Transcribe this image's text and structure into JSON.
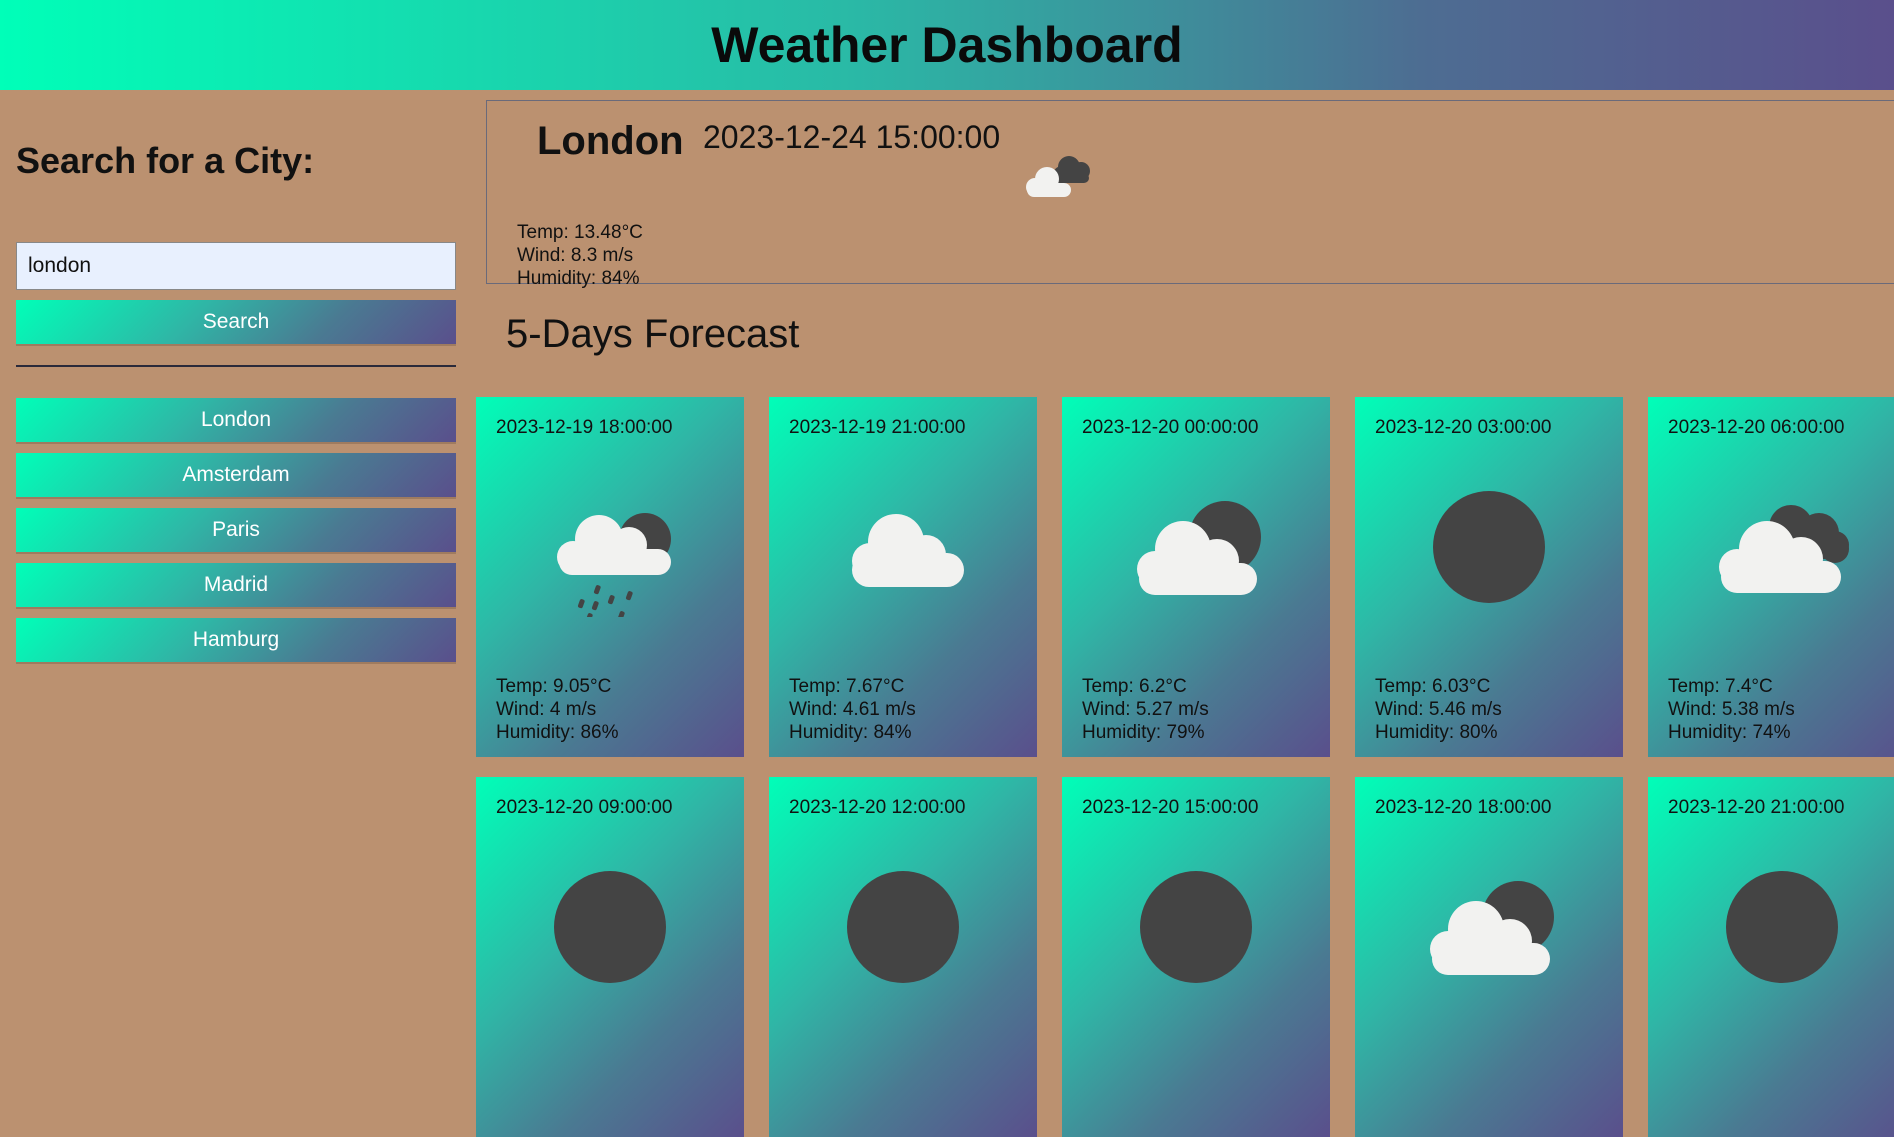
{
  "header": {
    "title": "Weather Dashboard"
  },
  "sidebar": {
    "heading": "Search for a City:",
    "search_value": "london",
    "search_button": "Search",
    "history": [
      "London",
      "Amsterdam",
      "Paris",
      "Madrid",
      "Hamburg"
    ]
  },
  "current": {
    "city": "London",
    "datetime": "2023-12-24 15:00:00",
    "icon": "broken-clouds-icon",
    "temp": "Temp: 13.48°C",
    "wind": "Wind: 8.3 m/s",
    "humidity": "Humidity: 84%"
  },
  "forecast": {
    "title": "5-Days Forecast",
    "cards": [
      {
        "date": "2023-12-19 18:00:00",
        "icon": "rain-icon",
        "temp": "Temp: 9.05°C",
        "wind": "Wind: 4 m/s",
        "humidity": "Humidity: 86%"
      },
      {
        "date": "2023-12-19 21:00:00",
        "icon": "cloud-icon",
        "temp": "Temp: 7.67°C",
        "wind": "Wind: 4.61 m/s",
        "humidity": "Humidity: 84%"
      },
      {
        "date": "2023-12-20 00:00:00",
        "icon": "few-clouds-night-icon",
        "temp": "Temp: 6.2°C",
        "wind": "Wind: 5.27 m/s",
        "humidity": "Humidity: 79%"
      },
      {
        "date": "2023-12-20 03:00:00",
        "icon": "clear-night-icon",
        "temp": "Temp: 6.03°C",
        "wind": "Wind: 5.46 m/s",
        "humidity": "Humidity: 80%"
      },
      {
        "date": "2023-12-20 06:00:00",
        "icon": "broken-clouds-icon",
        "temp": "Temp: 7.4°C",
        "wind": "Wind: 5.38 m/s",
        "humidity": "Humidity: 74%"
      },
      {
        "date": "2023-12-20 09:00:00",
        "icon": "clear-night-icon",
        "temp": "",
        "wind": "",
        "humidity": ""
      },
      {
        "date": "2023-12-20 12:00:00",
        "icon": "clear-night-icon",
        "temp": "",
        "wind": "",
        "humidity": ""
      },
      {
        "date": "2023-12-20 15:00:00",
        "icon": "clear-night-icon",
        "temp": "",
        "wind": "",
        "humidity": ""
      },
      {
        "date": "2023-12-20 18:00:00",
        "icon": "few-clouds-night-icon",
        "temp": "",
        "wind": "",
        "humidity": ""
      },
      {
        "date": "2023-12-20 21:00:00",
        "icon": "clear-night-icon",
        "temp": "",
        "wind": "",
        "humidity": ""
      }
    ]
  }
}
